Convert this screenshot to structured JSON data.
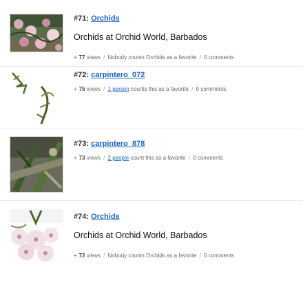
{
  "entries": [
    {
      "number": "#71:",
      "title": "Orchids",
      "description": "Orchids at Orchid World, Barbados",
      "views": "77",
      "views_label": "views",
      "favorite_link": "",
      "favorite_text": "Nobody counts Orchids as a favorite",
      "comments": "0 comments",
      "thumbnail_icon": "orchid-photo"
    },
    {
      "number": "#72:",
      "title": "carpintero_072",
      "description": "",
      "views": "75",
      "views_label": "views",
      "favorite_link": "1 person",
      "favorite_text": "counts this as a favorite",
      "comments": "0 comments",
      "thumbnail_icon": "woodpecker-drawing"
    },
    {
      "number": "#73:",
      "title": "carpintero_878",
      "description": "",
      "views": "73",
      "views_label": "views",
      "favorite_link": "2 people",
      "favorite_text": "count this as a favorite",
      "comments": "0 comments",
      "thumbnail_icon": "plant-photo"
    },
    {
      "number": "#74:",
      "title": "Orchids",
      "description": "Orchids at Orchid World, Barbados",
      "views": "72",
      "views_label": "views",
      "favorite_link": "",
      "favorite_text": "Nobody counts Orchids as a favorite",
      "comments": "0 comments",
      "thumbnail_icon": "orchid-photo"
    }
  ],
  "separator": "/",
  "bullet": "+"
}
